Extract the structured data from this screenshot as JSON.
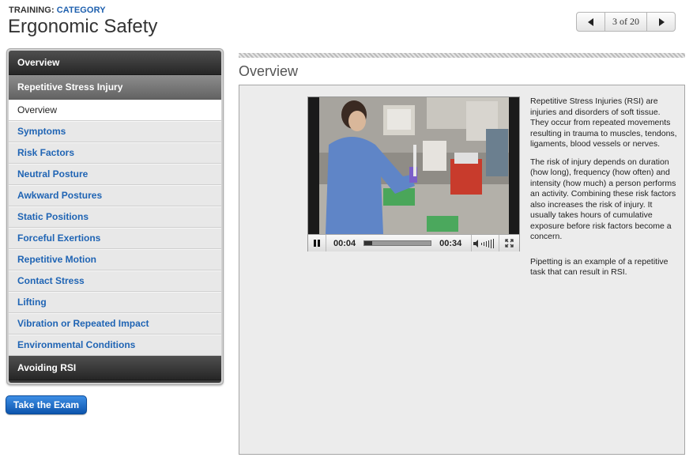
{
  "header": {
    "training_label": "TRAINING:",
    "category_label": "CATEGORY",
    "title": "Ergonomic Safety"
  },
  "pager": {
    "count_text": "3 of 20",
    "prev_icon": "arrow-left-icon",
    "next_icon": "arrow-right-icon"
  },
  "sidebar": {
    "overview_label": "Overview",
    "rsi_section_label": "Repetitive Stress Injury",
    "rsi_items": [
      {
        "label": "Overview",
        "active": true
      },
      {
        "label": "Symptoms",
        "active": false
      },
      {
        "label": "Risk Factors",
        "active": false
      },
      {
        "label": "Neutral Posture",
        "active": false
      },
      {
        "label": "Awkward Postures",
        "active": false
      },
      {
        "label": "Static Positions",
        "active": false
      },
      {
        "label": "Forceful Exertions",
        "active": false
      },
      {
        "label": "Repetitive Motion",
        "active": false
      },
      {
        "label": "Contact Stress",
        "active": false
      },
      {
        "label": "Lifting",
        "active": false
      },
      {
        "label": "Vibration or Repeated Impact",
        "active": false
      },
      {
        "label": "Environmental Conditions",
        "active": false
      }
    ],
    "avoiding_label": "Avoiding RSI"
  },
  "exam_button_label": "Take the Exam",
  "content": {
    "heading": "Overview",
    "video": {
      "current_time": "00:04",
      "duration": "00:34",
      "progress_fraction": 0.12
    },
    "paragraphs": [
      "Repetitive Stress Injuries (RSI) are injuries and disorders of soft tissue. They occur from repeated movements resulting in trauma to muscles, tendons, ligaments, blood vessels or nerves.",
      "The risk of injury depends on duration (how long), frequency (how often) and intensity (how much) a person performs an activity. Combining these risk factors also increases the risk of injury. It usually takes hours of cumulative exposure before risk factors become a concern.",
      "Pipetting is an example of a repetitive task that can result in RSI."
    ]
  },
  "colors": {
    "link_blue": "#1f64b4",
    "dark_header": "#262626",
    "exam_blue": "#0d55ad"
  }
}
